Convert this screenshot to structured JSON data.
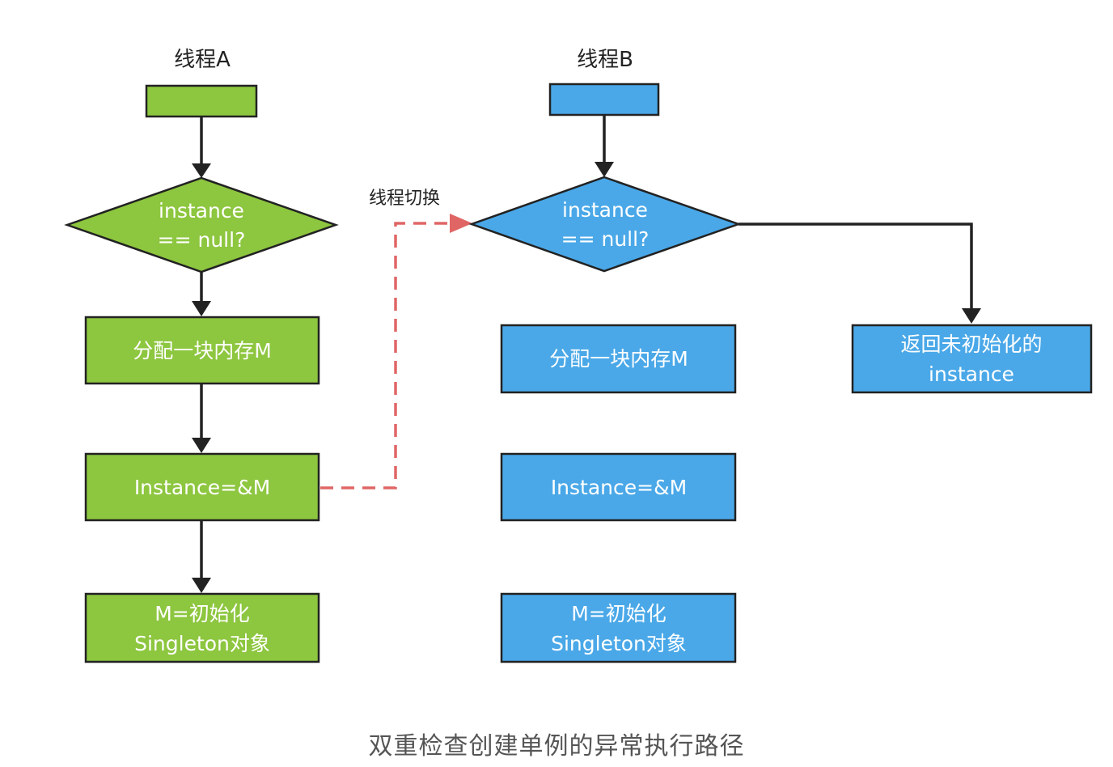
{
  "thread_a": {
    "title": "线程A",
    "decision": [
      "instance",
      "== null?"
    ],
    "alloc": "分配一块内存M",
    "assign": "Instance=&M",
    "init": [
      "M=初始化",
      "Singleton对象"
    ]
  },
  "thread_b": {
    "title": "线程B",
    "decision": [
      "instance",
      "== null?"
    ],
    "alloc": "分配一块内存M",
    "assign": "Instance=&M",
    "init": [
      "M=初始化",
      "Singleton对象"
    ],
    "return_box": [
      "返回未初始化的",
      "instance"
    ]
  },
  "switch_label": "线程切换",
  "caption": "双重检查创建单例的异常执行路径",
  "colors": {
    "green": "#8dc63f",
    "blue": "#4aa8e8",
    "stroke": "#222222",
    "dashed": "#e06666"
  }
}
